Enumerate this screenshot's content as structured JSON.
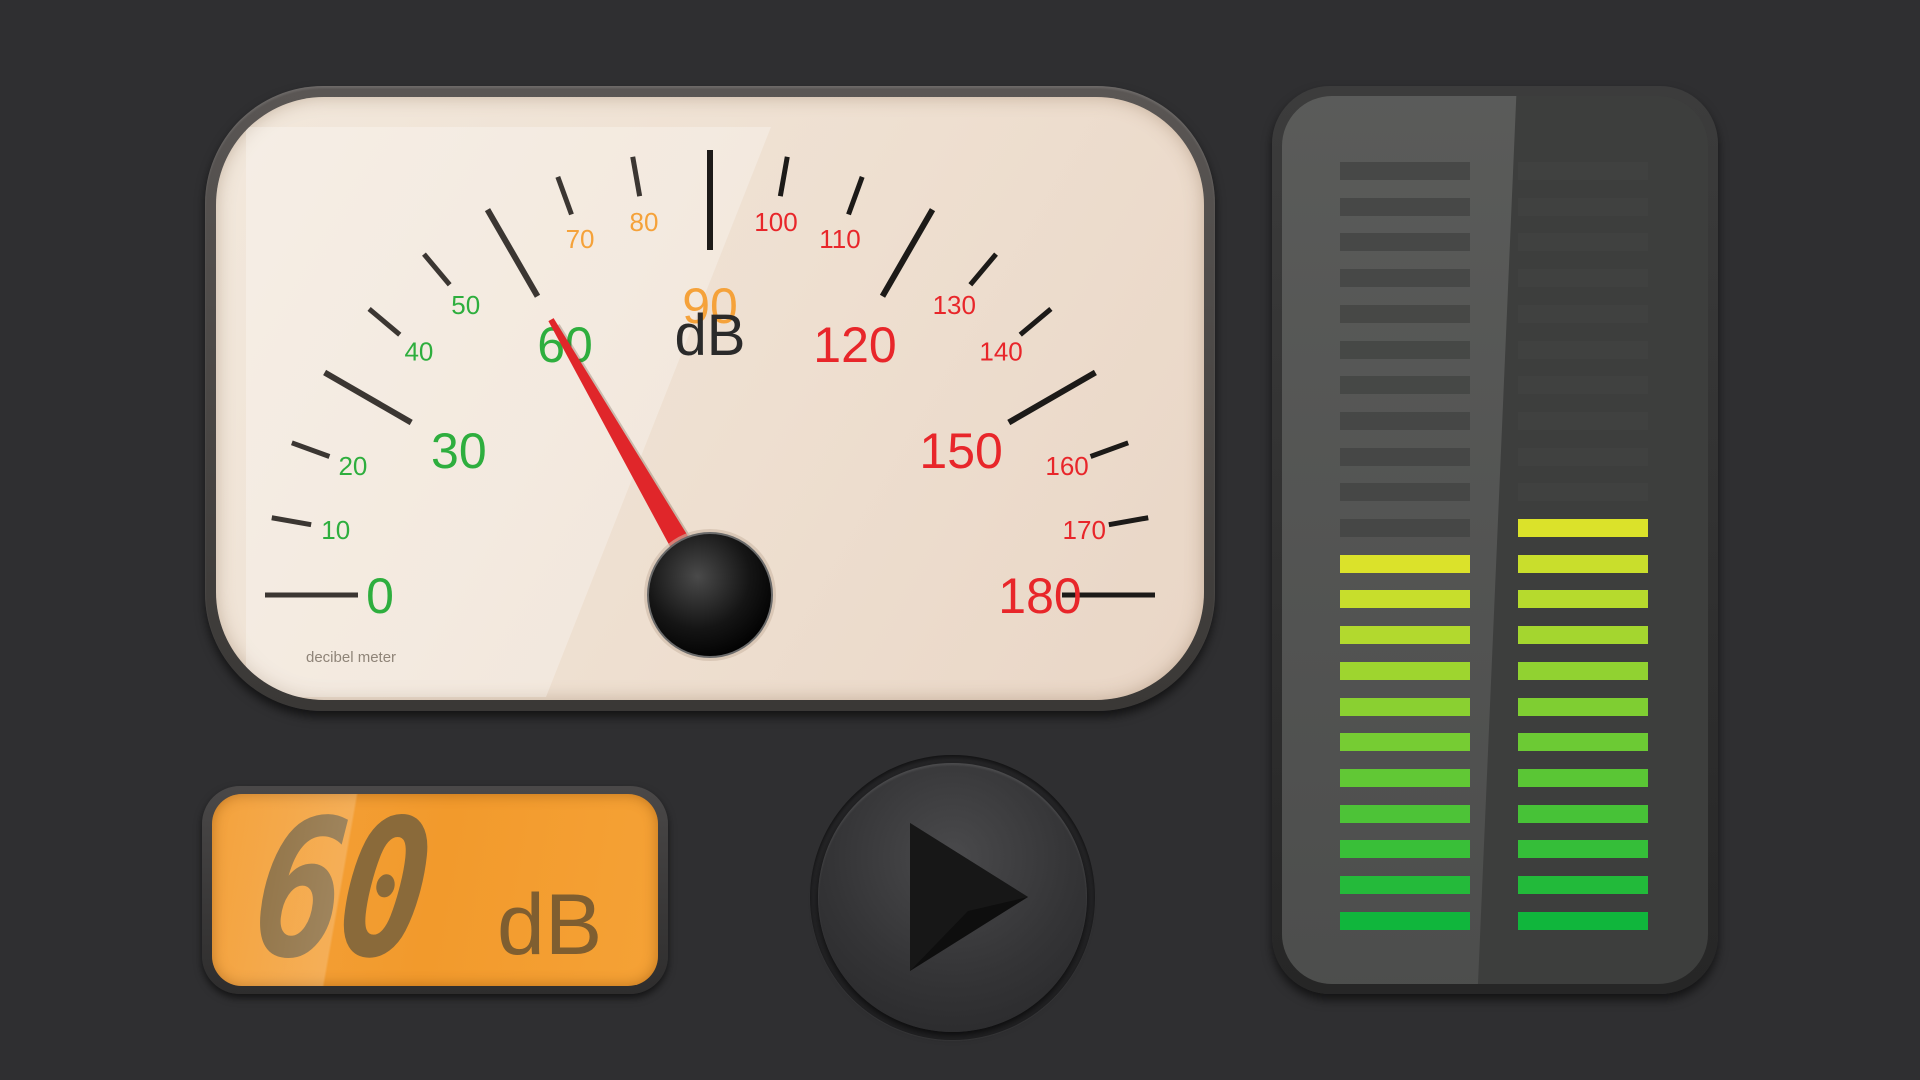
{
  "gauge": {
    "unit": "dB",
    "brand": "decibel meter",
    "min": 0,
    "max": 180,
    "reading": 60,
    "major_labels": [
      "0",
      "30",
      "60",
      "90",
      "120",
      "150",
      "180"
    ],
    "minor_labels": [
      "10",
      "20",
      "40",
      "50",
      "70",
      "80",
      "100",
      "110",
      "130",
      "140",
      "160",
      "170"
    ],
    "colors": {
      "green": "#2eae3e",
      "orange": "#f5a23a",
      "red": "#e8262a",
      "needle": "#e0262a"
    }
  },
  "readout": {
    "value": "60",
    "unit": "dB"
  },
  "play_button": {
    "icon": "play-icon"
  },
  "vu_meter": {
    "segment_count": 22,
    "left_lit": 11,
    "right_lit": 12,
    "colors": {
      "top": "#dbe22a",
      "bottom": "#10b63c",
      "off": "#424342"
    }
  }
}
